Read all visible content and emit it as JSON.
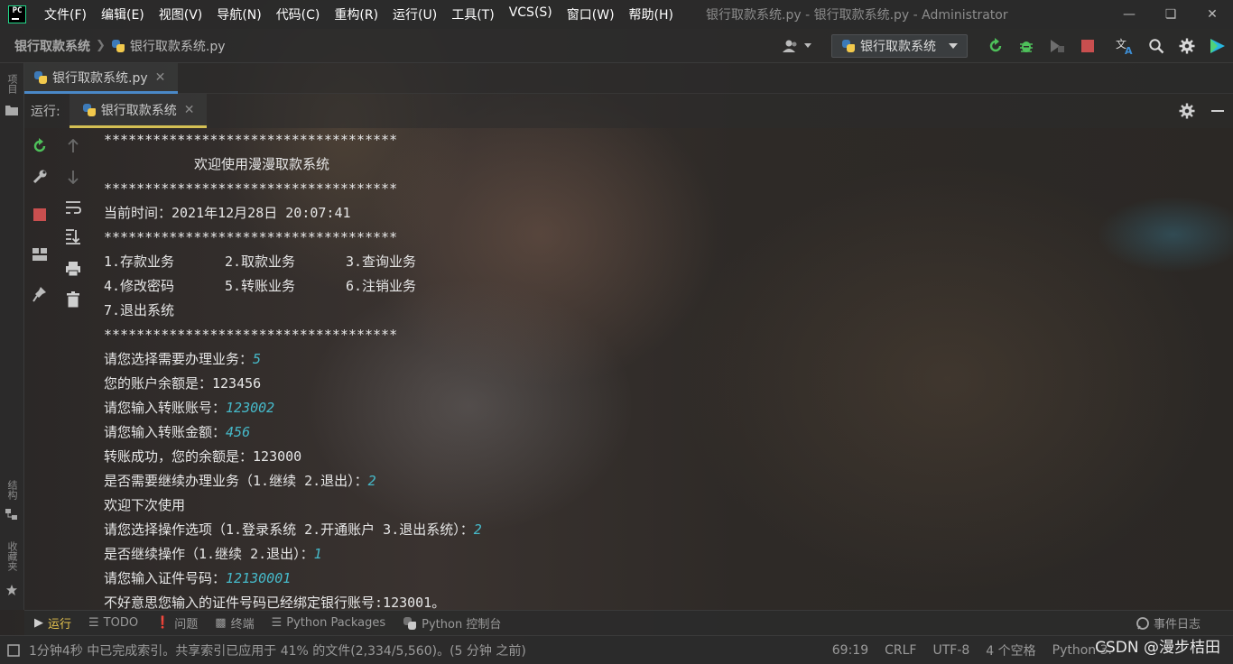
{
  "app": {
    "logo_text": "PC",
    "window_title": "银行取款系统.py - 银行取款系统.py - Administrator",
    "menu": [
      "文件(F)",
      "编辑(E)",
      "视图(V)",
      "导航(N)",
      "代码(C)",
      "重构(R)",
      "运行(U)",
      "工具(T)",
      "VCS(S)",
      "窗口(W)",
      "帮助(H)"
    ]
  },
  "breadcrumb": {
    "project": "银行取款系统",
    "file": "银行取款系统.py"
  },
  "toolbar": {
    "run_config": "银行取款系统",
    "user_icon": "user-icon",
    "icons": [
      "rerun-icon",
      "debug-icon",
      "coverage-icon",
      "stop-icon",
      "translate-icon",
      "search-icon",
      "settings-icon",
      "plugin-icon"
    ]
  },
  "left_stripe": {
    "project_label": "项目",
    "structure_label": "结构",
    "favorites_label": "收藏夹"
  },
  "editor_tabs": [
    {
      "label": "银行取款系统.py"
    }
  ],
  "run_panel": {
    "label": "运行:",
    "tab_label": "银行取款系统"
  },
  "console": {
    "stars": "************************************",
    "welcome": "欢迎使用漫漫取款系统",
    "time_line": "当前时间：2021年12月28日 20:07:41",
    "menu_row1": [
      "1.存款业务",
      "2.取款业务",
      "3.查询业务"
    ],
    "menu_row2": [
      "4.修改密码",
      "5.转账业务",
      "6.注销业务"
    ],
    "menu_row3": "7.退出系统",
    "lines": [
      {
        "text": "请您选择需要办理业务：",
        "input": "5"
      },
      {
        "text": "您的账户余额是：123456",
        "input": ""
      },
      {
        "text": "请您输入转账账号：",
        "input": "123002"
      },
      {
        "text": "请您输入转账金额：",
        "input": "456"
      },
      {
        "text": "转账成功，您的余额是：123000",
        "input": ""
      },
      {
        "text": "是否需要继续办理业务（1.继续 2.退出）：",
        "input": "2"
      },
      {
        "text": "欢迎下次使用",
        "input": ""
      },
      {
        "text": "请您选择操作选项（1.登录系统 2.开通账户 3.退出系统）：",
        "input": "2"
      },
      {
        "text": "是否继续操作（1.继续 2.退出）：",
        "input": "1"
      },
      {
        "text": "请您输入证件号码：",
        "input": "12130001"
      },
      {
        "text": "不好意思您输入的证件号码已经绑定银行账号:123001。",
        "input": ""
      }
    ]
  },
  "bottom_tabs": {
    "run": "运行",
    "todo": "TODO",
    "problems": "问题",
    "terminal": "终端",
    "packages": "Python Packages",
    "console": "Python 控制台",
    "event_log": "事件日志"
  },
  "status": {
    "message": "1分钟4秒 中已完成索引。共享索引已应用于 41% 的文件(2,334/5,560)。(5 分钟 之前)",
    "position": "69:19",
    "line_sep": "CRLF",
    "encoding": "UTF-8",
    "indent": "4 个空格",
    "interpreter": "Python 3.",
    "watermark": "CSDN @漫步桔田"
  }
}
